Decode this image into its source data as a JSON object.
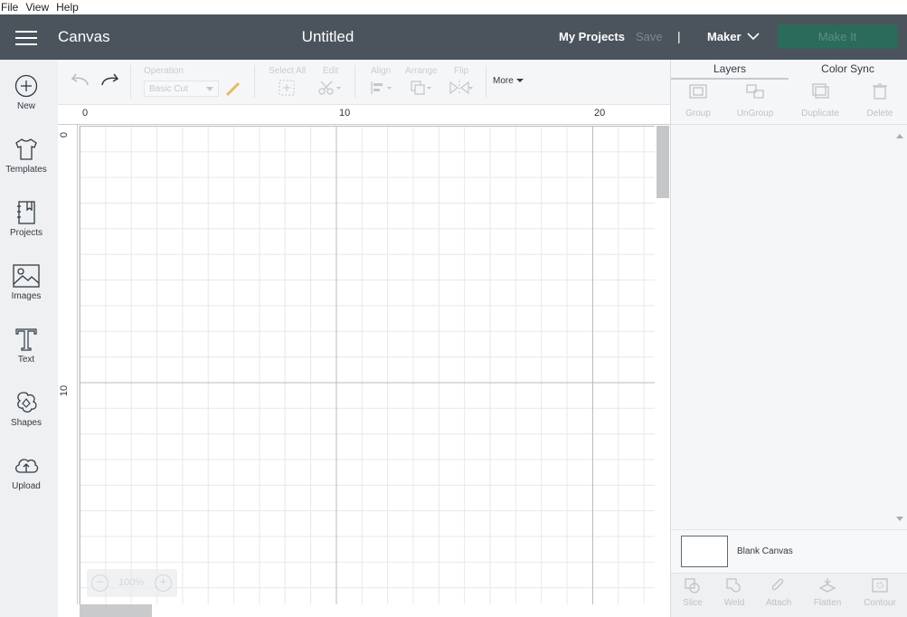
{
  "menubar": {
    "items": [
      "File",
      "View",
      "Help"
    ]
  },
  "header": {
    "app_name": "Canvas",
    "doc_title": "Untitled",
    "my_projects": "My Projects",
    "save": "Save",
    "separator": "|",
    "machine": "Maker",
    "make_it": "Make It"
  },
  "sidebar": {
    "items": [
      {
        "label": "New",
        "icon": "plus-circle-icon"
      },
      {
        "label": "Templates",
        "icon": "tshirt-icon"
      },
      {
        "label": "Projects",
        "icon": "notebook-icon"
      },
      {
        "label": "Images",
        "icon": "image-icon"
      },
      {
        "label": "Text",
        "icon": "text-t-icon"
      },
      {
        "label": "Shapes",
        "icon": "shapes-icon"
      },
      {
        "label": "Upload",
        "icon": "cloud-upload-icon"
      }
    ]
  },
  "toolbar": {
    "operation_label": "Operation",
    "operation_value": "Basic Cut",
    "select_all_label": "Select All",
    "edit_label": "Edit",
    "align_label": "Align",
    "arrange_label": "Arrange",
    "flip_label": "Flip",
    "more_label": "More"
  },
  "ruler": {
    "top": [
      "0",
      "10",
      "20"
    ],
    "left": [
      "0",
      "10"
    ]
  },
  "zoom": {
    "value": "100%",
    "minus": "−",
    "plus": "+"
  },
  "right_panel": {
    "tabs": [
      "Layers",
      "Color Sync"
    ],
    "actions": [
      "Group",
      "UnGroup",
      "Duplicate",
      "Delete"
    ],
    "blank_canvas_label": "Blank Canvas",
    "bottom_actions": [
      "Slice",
      "Weld",
      "Attach",
      "Flatten",
      "Contour"
    ]
  }
}
